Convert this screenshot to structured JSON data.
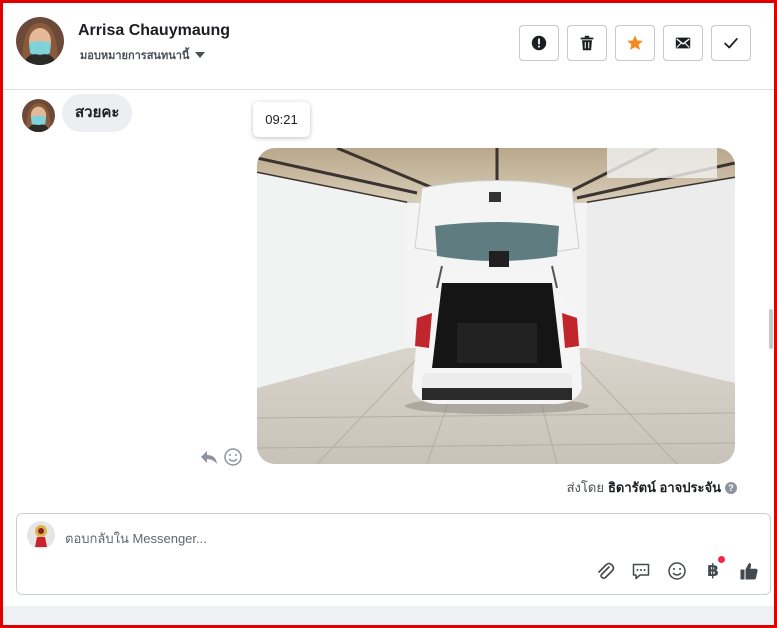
{
  "header": {
    "contact_name": "Arrisa Chauymaung",
    "assign_label": "มอบหมายการสนทนานี้",
    "actions": [
      {
        "icon": "exclamation-icon",
        "label": "spam"
      },
      {
        "icon": "trash-icon",
        "label": "delete"
      },
      {
        "icon": "star-icon",
        "label": "star"
      },
      {
        "icon": "envelope-icon",
        "label": "mark-unread"
      },
      {
        "icon": "check-icon",
        "label": "done"
      }
    ]
  },
  "conversation": {
    "incoming_message": "สวยคะ",
    "timestamp_tooltip": "09:21",
    "sent_by_prefix": "ส่งโดย",
    "sent_by_name": "ธิดารัตน์ อาจประจัน",
    "help_mark": "?"
  },
  "composer": {
    "placeholder": "ตอบกลับใน Messenger...",
    "tools": [
      "paperclip-icon",
      "saved-reply-icon",
      "emoji-icon",
      "baht-payment-icon",
      "thumbs-up-icon"
    ],
    "baht_symbol": "฿"
  },
  "colors": {
    "frame_border": "#e00000",
    "star_accent": "#f28a1e",
    "notify_dot": "#f0284a",
    "bubble_bg": "#eceef1"
  }
}
